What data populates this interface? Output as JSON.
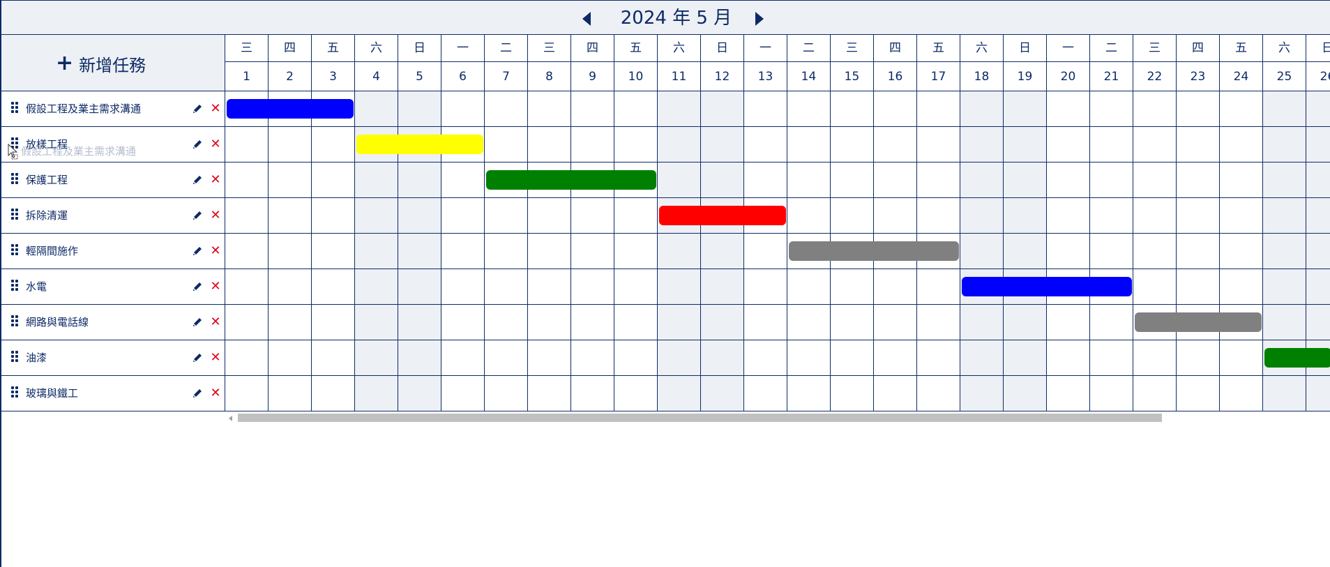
{
  "header": {
    "month_title": "2024 年 5 月",
    "prev_icon": "caret-left-icon",
    "next_icon": "caret-right-icon"
  },
  "toolbar": {
    "add_task_label": "新增任務",
    "add_icon": "plus-icon"
  },
  "days": [
    {
      "d": "1",
      "w": "三"
    },
    {
      "d": "2",
      "w": "四"
    },
    {
      "d": "3",
      "w": "五"
    },
    {
      "d": "4",
      "w": "六"
    },
    {
      "d": "5",
      "w": "日"
    },
    {
      "d": "6",
      "w": "一"
    },
    {
      "d": "7",
      "w": "二"
    },
    {
      "d": "8",
      "w": "三"
    },
    {
      "d": "9",
      "w": "四"
    },
    {
      "d": "10",
      "w": "五"
    },
    {
      "d": "11",
      "w": "六"
    },
    {
      "d": "12",
      "w": "日"
    },
    {
      "d": "13",
      "w": "一"
    },
    {
      "d": "14",
      "w": "二"
    },
    {
      "d": "15",
      "w": "三"
    },
    {
      "d": "16",
      "w": "四"
    },
    {
      "d": "17",
      "w": "五"
    },
    {
      "d": "18",
      "w": "六"
    },
    {
      "d": "19",
      "w": "日"
    },
    {
      "d": "20",
      "w": "一"
    },
    {
      "d": "21",
      "w": "二"
    },
    {
      "d": "22",
      "w": "三"
    },
    {
      "d": "23",
      "w": "四"
    },
    {
      "d": "24",
      "w": "五"
    },
    {
      "d": "25",
      "w": "六"
    },
    {
      "d": "26",
      "w": "日"
    }
  ],
  "weekend_days": [
    4,
    5,
    11,
    12,
    18,
    19,
    25,
    26
  ],
  "tasks": [
    {
      "name": "假設工程及業主需求溝通",
      "start": 1,
      "end": 3,
      "color": "#0000ff"
    },
    {
      "name": "放樣工程",
      "start": 4,
      "end": 6,
      "color": "#ffff00"
    },
    {
      "name": "保護工程",
      "start": 7,
      "end": 10,
      "color": "#008000"
    },
    {
      "name": "拆除清運",
      "start": 11,
      "end": 13,
      "color": "#ff0000"
    },
    {
      "name": "輕隔間施作",
      "start": 14,
      "end": 17,
      "color": "#808080"
    },
    {
      "name": "水電",
      "start": 18,
      "end": 21,
      "color": "#0000ff"
    },
    {
      "name": "網路與電話線",
      "start": 22,
      "end": 24,
      "color": "#808080"
    },
    {
      "name": "油漆",
      "start": 25,
      "end": 27,
      "color": "#008000"
    },
    {
      "name": "玻璃與鐵工",
      "start": null,
      "end": null,
      "color": null
    }
  ],
  "row_icons": {
    "drag": "drag-handle-icon",
    "edit": "pencil-icon",
    "delete": "close-icon"
  },
  "drag_ghost": {
    "label": "假設工程及業主需求溝通"
  }
}
